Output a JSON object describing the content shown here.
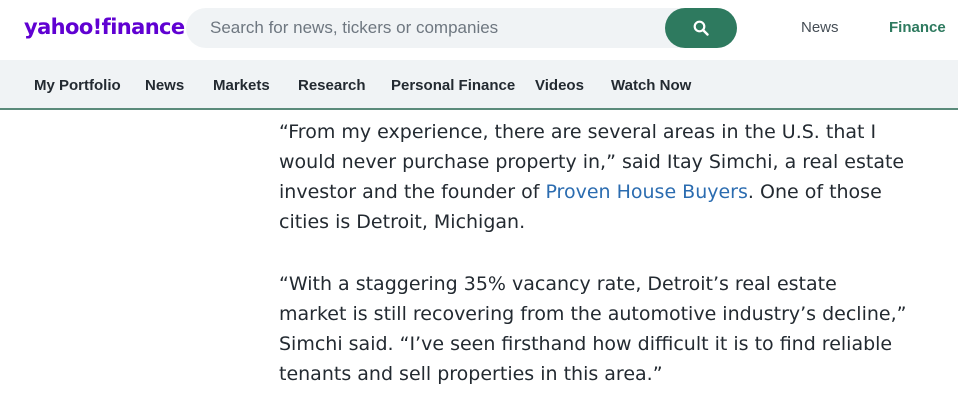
{
  "header": {
    "logo_text": "yahoo",
    "logo_excl": "!",
    "logo_suffix": "finance",
    "search_placeholder": "Search for news, tickers or companies",
    "search_icon": "search-icon",
    "links": {
      "news": "News",
      "finance": "Finance"
    }
  },
  "nav": {
    "items": [
      "My Portfolio",
      "News",
      "Markets",
      "Research",
      "Personal Finance",
      "Videos",
      "Watch Now"
    ]
  },
  "article": {
    "p1": {
      "before": "“From my experience, there are several areas in the U.S. that I would never purchase property in,” said Itay Simchi, a real estate investor and the founder of ",
      "link": "Proven House Buyers",
      "after": ". One of those cities is Detroit, Michigan."
    },
    "p2": "“With a staggering 35% vacancy rate, Detroit’s real estate market is still recovering from the automotive industry’s decline,” Simchi said. “I’ve seen firsthand how difficult it is to find reliable tenants and sell properties in this area.”"
  },
  "colors": {
    "brand": "#6001d2",
    "accent": "#2e7a5f",
    "link": "#2b6cb0"
  }
}
